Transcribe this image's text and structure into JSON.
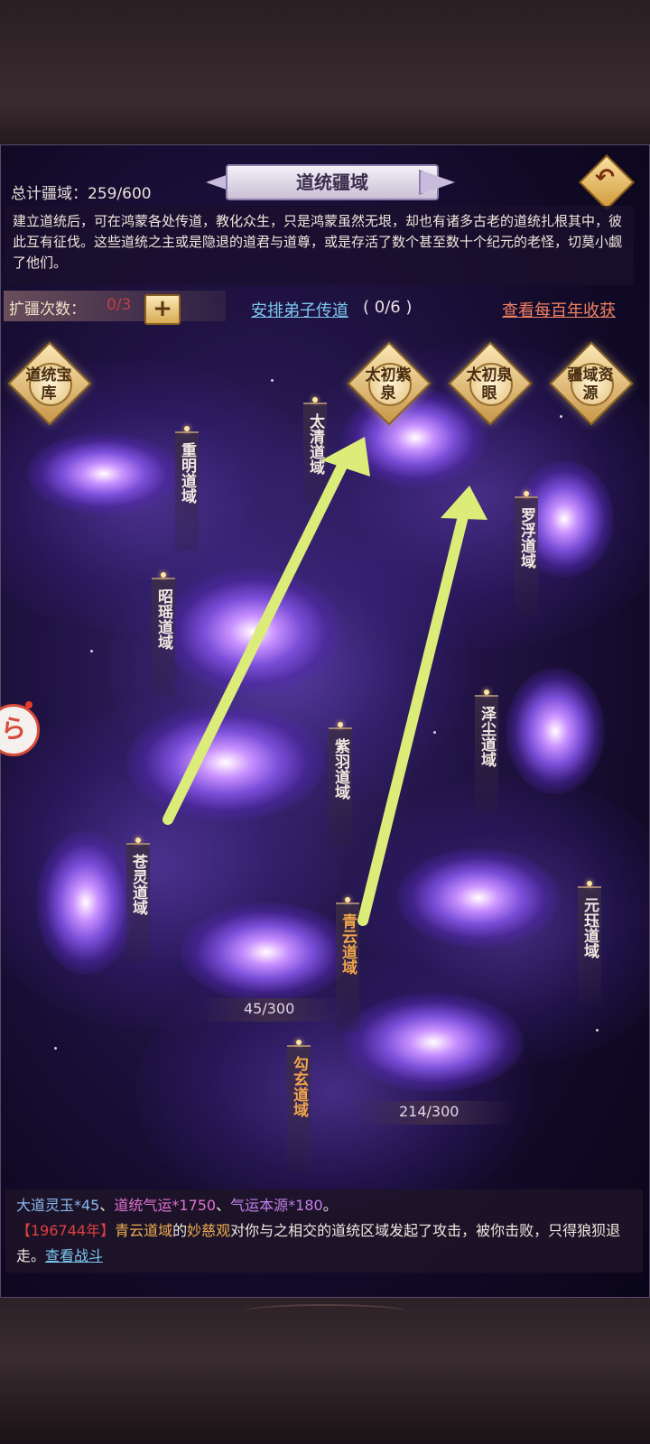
{
  "header": {
    "title": "道统疆域",
    "back_icon": "back-arrow-icon",
    "total_label": "总计疆域：259/600"
  },
  "description": "建立道统后，可在鸿蒙各处传道，教化众生，只是鸿蒙虽然无垠，却也有诸多古老的道统扎根其中，彼此互有征伐。这些道统之主或是隐退的道君与道尊，或是存活了数个甚至数十个纪元的老怪，切莫小觑了他们。",
  "toolbar": {
    "expand_label": "扩疆次数：",
    "expand_value": "0/3",
    "plus_label": "+",
    "assign_link": "安排弟子传道",
    "assign_count": "( 0/6 )",
    "harvest_link": "查看每百年收获"
  },
  "badges": [
    {
      "label": "道统宝库"
    },
    {
      "label": "太初紫泉"
    },
    {
      "label": "太初泉眼"
    },
    {
      "label": "疆域资源"
    }
  ],
  "domains": [
    {
      "name": "太清道域"
    },
    {
      "name": "重明道域"
    },
    {
      "name": "罗浮道域"
    },
    {
      "name": "昭瑶道域"
    },
    {
      "name": "泽尘道域"
    },
    {
      "name": "紫羽道域"
    },
    {
      "name": "苍灵道域"
    },
    {
      "name": "青云道域"
    },
    {
      "name": "元珏道域"
    },
    {
      "name": "勾玄道域"
    }
  ],
  "counts": {
    "left": "45/300",
    "right": "214/300"
  },
  "side_button": {
    "icon": "event-badge-icon"
  },
  "log": {
    "rewards": {
      "item1": "大道灵玉*45",
      "sep1": "、",
      "item2": "道统气运*1750",
      "sep2": "、",
      "item3": "气运本源*180",
      "end": "。"
    },
    "year": "【196744年】",
    "domain": "青云道域",
    "of": "的",
    "temple": "妙慈观",
    "message": "对你与之相交的道统区域发起了攻击，被你击败，只得狼狈退走。",
    "battle_link": "查看战斗"
  },
  "colors": {
    "accent_gold": "#f0b050",
    "link_blue": "#7cc8f0",
    "link_orange": "#f08060",
    "annotation_arrow": "#dcec78"
  }
}
